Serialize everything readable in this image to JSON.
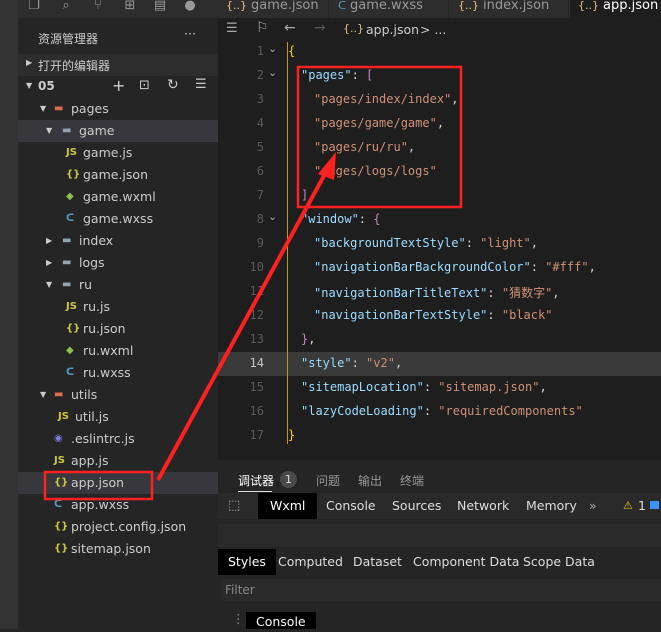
{
  "tabs": [
    {
      "label": "game.json",
      "icon": "json-icon"
    },
    {
      "label": "game.wxss",
      "icon": "css-icon"
    },
    {
      "label": "index.json",
      "icon": "json-icon"
    },
    {
      "label": "app.json",
      "icon": "json-icon",
      "active": true
    }
  ],
  "sidebar": {
    "title": "资源管理器",
    "more": "···",
    "open_editors": "打开的编辑器",
    "project": "05",
    "tree": [
      {
        "label": "pages",
        "type": "folder",
        "depth": 0,
        "open": true,
        "icon": "folder-pages-icon"
      },
      {
        "label": "game",
        "type": "folder",
        "depth": 1,
        "open": true,
        "selected": true
      },
      {
        "label": "game.js",
        "type": "js",
        "depth": 2
      },
      {
        "label": "game.json",
        "type": "json",
        "depth": 2
      },
      {
        "label": "game.wxml",
        "type": "wxml",
        "depth": 2
      },
      {
        "label": "game.wxss",
        "type": "wxss",
        "depth": 2
      },
      {
        "label": "index",
        "type": "folder",
        "depth": 1,
        "open": false
      },
      {
        "label": "logs",
        "type": "folder",
        "depth": 1,
        "open": false
      },
      {
        "label": "ru",
        "type": "folder",
        "depth": 1,
        "open": true
      },
      {
        "label": "ru.js",
        "type": "js",
        "depth": 2
      },
      {
        "label": "ru.json",
        "type": "json",
        "depth": 2
      },
      {
        "label": "ru.wxml",
        "type": "wxml",
        "depth": 2
      },
      {
        "label": "ru.wxss",
        "type": "wxss",
        "depth": 2
      },
      {
        "label": "utils",
        "type": "folder",
        "depth": 0,
        "open": true
      },
      {
        "label": "util.js",
        "type": "js",
        "depth": 1
      },
      {
        "label": ".eslintrc.js",
        "type": "eslint",
        "depth": 0
      },
      {
        "label": "app.js",
        "type": "js",
        "depth": 0
      },
      {
        "label": "app.json",
        "type": "json",
        "depth": 0,
        "selected": true,
        "highlighted": true
      },
      {
        "label": "app.wxss",
        "type": "wxss",
        "depth": 0
      },
      {
        "label": "project.config.json",
        "type": "json",
        "depth": 0
      },
      {
        "label": "sitemap.json",
        "type": "json",
        "depth": 0
      }
    ]
  },
  "editor": {
    "breadcrumb": "app.json",
    "breadcrumb_more": "> ...",
    "current_line": 14,
    "lines": [
      [
        [
          "b",
          "{"
        ]
      ],
      [
        [
          "k",
          "\"pages\""
        ],
        [
          "d",
          ": "
        ],
        [
          "p",
          "["
        ]
      ],
      [
        [
          "s",
          "\"pages/index/index\""
        ],
        [
          "d",
          ","
        ]
      ],
      [
        [
          "s",
          "\"pages/game/game\""
        ],
        [
          "d",
          ","
        ]
      ],
      [
        [
          "s",
          "\"pages/ru/ru\""
        ],
        [
          "d",
          ","
        ]
      ],
      [
        [
          "s",
          "\"pages/logs/logs\""
        ]
      ],
      [
        [
          "p",
          "]"
        ],
        [
          "d",
          ","
        ]
      ],
      [
        [
          "k",
          "\"window\""
        ],
        [
          "d",
          ": "
        ],
        [
          "p",
          "{"
        ]
      ],
      [
        [
          "k",
          "\"backgroundTextStyle\""
        ],
        [
          "d",
          ": "
        ],
        [
          "s",
          "\"light\""
        ],
        [
          "d",
          ","
        ]
      ],
      [
        [
          "k",
          "\"navigationBarBackgroundColor\""
        ],
        [
          "d",
          ": "
        ],
        [
          "s",
          "\"#fff\""
        ],
        [
          "d",
          ","
        ]
      ],
      [
        [
          "k",
          "\"navigationBarTitleText\""
        ],
        [
          "d",
          ": "
        ],
        [
          "s",
          "\"猜数字\""
        ],
        [
          "d",
          ","
        ]
      ],
      [
        [
          "k",
          "\"navigationBarTextStyle\""
        ],
        [
          "d",
          ": "
        ],
        [
          "s",
          "\"black\""
        ]
      ],
      [
        [
          "p",
          "}"
        ],
        [
          "d",
          ","
        ]
      ],
      [
        [
          "k",
          "\"style\""
        ],
        [
          "d",
          ": "
        ],
        [
          "s",
          "\"v2\""
        ],
        [
          "d",
          ","
        ]
      ],
      [
        [
          "k",
          "\"sitemapLocation\""
        ],
        [
          "d",
          ": "
        ],
        [
          "s",
          "\"sitemap.json\""
        ],
        [
          "d",
          ","
        ]
      ],
      [
        [
          "k",
          "\"lazyCodeLoading\""
        ],
        [
          "d",
          ": "
        ],
        [
          "s",
          "\"requiredComponents\""
        ]
      ],
      [
        [
          "b",
          "}"
        ]
      ]
    ],
    "indent": [
      0,
      1,
      2,
      2,
      2,
      2,
      1,
      1,
      2,
      2,
      2,
      2,
      1,
      1,
      1,
      1,
      0
    ]
  },
  "panel": {
    "tabs": [
      "调试器",
      "问题",
      "输出",
      "终端"
    ],
    "badge": "1",
    "devtools": [
      "Wxml",
      "Console",
      "Sources",
      "Network",
      "Memory"
    ],
    "more": "»",
    "warnings": "1",
    "style_tabs": [
      "Styles",
      "Computed",
      "Dataset",
      "Component Data",
      "Scope Data"
    ],
    "filter_placeholder": "Filter",
    "drawer_tab": "Console"
  },
  "colors": {
    "annotation": "#ff2020",
    "key": "#9cdcfe",
    "string": "#ce9178"
  }
}
